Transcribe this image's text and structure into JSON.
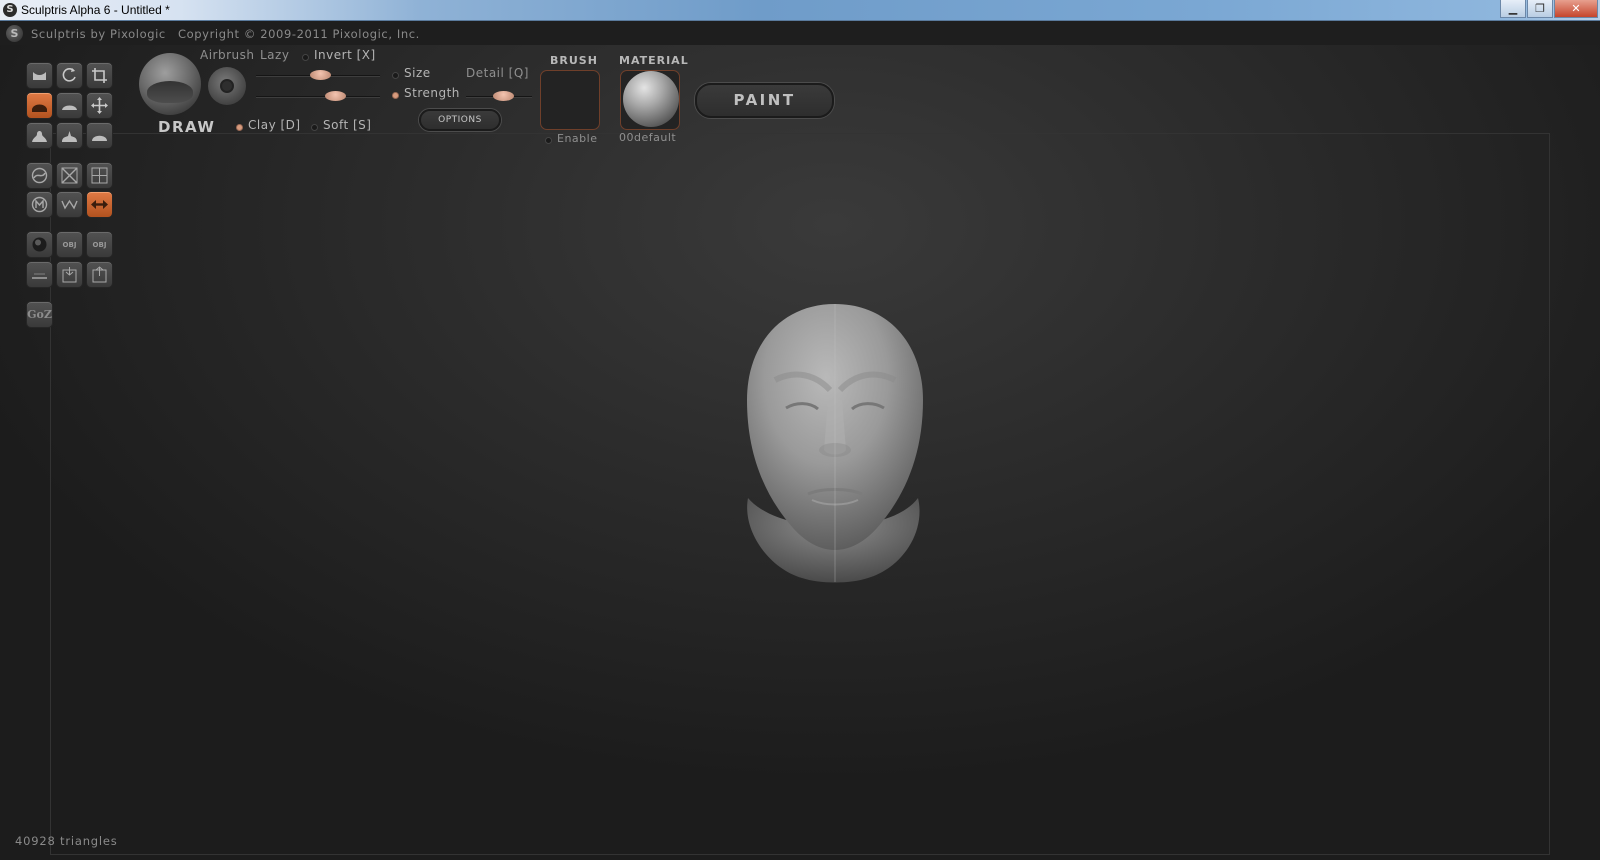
{
  "window": {
    "title": "Sculptris Alpha 6 - Untitled *",
    "app_icon_glyph": "S",
    "buttons": {
      "minimize": "▁",
      "restore": "❐",
      "close": "✕"
    }
  },
  "header": {
    "brand": "Sculptris by Pixologic",
    "copyright": "Copyright © 2009-2011 Pixologic, Inc."
  },
  "tools": [
    {
      "name": "crease-icon",
      "active": false
    },
    {
      "name": "rotate-icon",
      "active": false
    },
    {
      "name": "scale-icon",
      "active": false
    },
    {
      "name": "draw-icon",
      "active": true
    },
    {
      "name": "flatten-icon",
      "active": false
    },
    {
      "name": "grab-icon",
      "active": false
    },
    {
      "name": "pinch-icon",
      "active": false
    },
    {
      "name": "inflate-icon",
      "active": false
    },
    {
      "name": "smooth-icon",
      "active": false
    },
    {
      "name": "reduce-brush-icon",
      "active": false
    },
    {
      "name": "mask-icon",
      "active": false
    },
    {
      "name": "wireframe-icon",
      "active": false
    },
    {
      "name": "mask-m-icon",
      "active": false
    },
    {
      "name": "subdivide-icon",
      "active": false
    },
    {
      "name": "symmetry-icon",
      "active": true
    },
    {
      "name": "new-sphere-icon",
      "active": false
    },
    {
      "name": "import-obj-icon",
      "label": "OBJ",
      "active": false
    },
    {
      "name": "export-obj-icon",
      "label": "OBJ",
      "active": false
    },
    {
      "name": "new-plane-icon",
      "active": false
    },
    {
      "name": "open-icon",
      "active": false
    },
    {
      "name": "save-icon",
      "active": false
    },
    {
      "name": "goz-icon",
      "label": "GoZ",
      "active": false
    }
  ],
  "brush": {
    "tool_name": "DRAW",
    "airbrush_label": "Airbrush",
    "lazy_label": "Lazy",
    "invert_label": "Invert [X]",
    "invert_on": false,
    "size_label": "Size",
    "size_selected": false,
    "strength_label": "Strength",
    "strength_selected": true,
    "detail_label": "Detail [Q]",
    "clay_label": "Clay [D]",
    "clay_on": true,
    "soft_label": "Soft [S]",
    "soft_on": false,
    "options_label": "OPTIONS",
    "size_value": 0.52,
    "strength_value": 0.64,
    "detail_value": 0.56
  },
  "brush_section": {
    "title": "BRUSH",
    "enable_label": "Enable",
    "enabled": false
  },
  "material_section": {
    "title": "MATERIAL",
    "name": "00default"
  },
  "paint_button": {
    "label": "PAINT"
  },
  "status": {
    "triangles": "40928 triangles"
  }
}
